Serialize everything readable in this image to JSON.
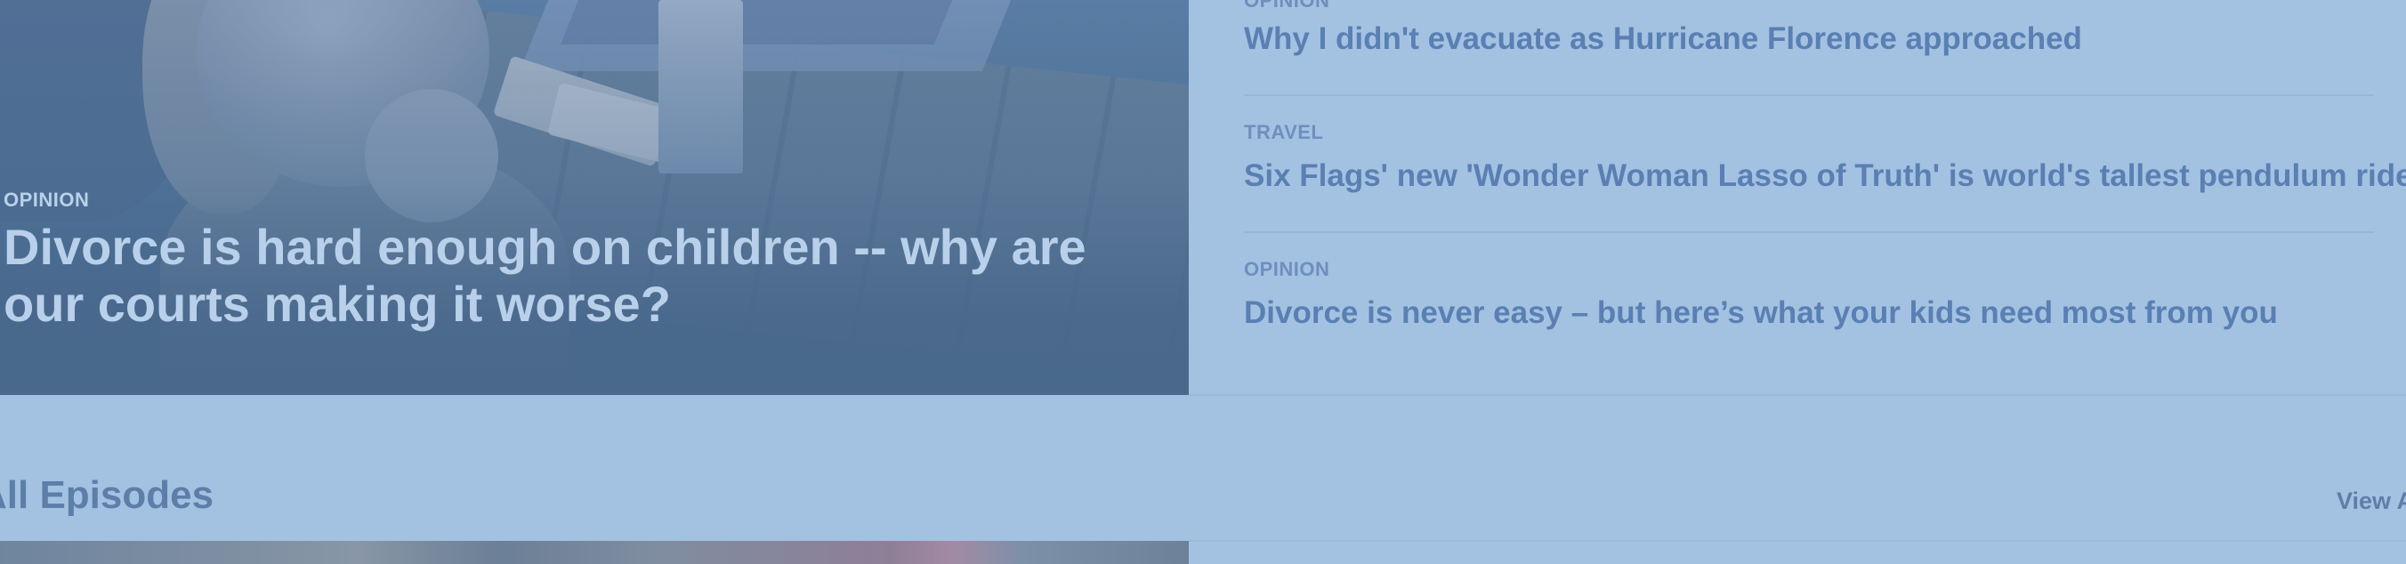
{
  "hero": {
    "kicker": "OPINION",
    "title": "Divorce is hard enough on children -- why are our courts making it worse?"
  },
  "stories": [
    {
      "kicker": "OPINION",
      "title": "Why I didn't evacuate as Hurricane Florence approached"
    },
    {
      "kicker": "TRAVEL",
      "title": "Six Flags' new 'Wonder Woman Lasso of Truth' is world's tallest pendulum ride"
    },
    {
      "kicker": "OPINION",
      "title": "Divorce is never easy – but here’s what your kids need most from you"
    }
  ],
  "episodes": {
    "title": "All Episodes",
    "view_all_label": "View All"
  }
}
